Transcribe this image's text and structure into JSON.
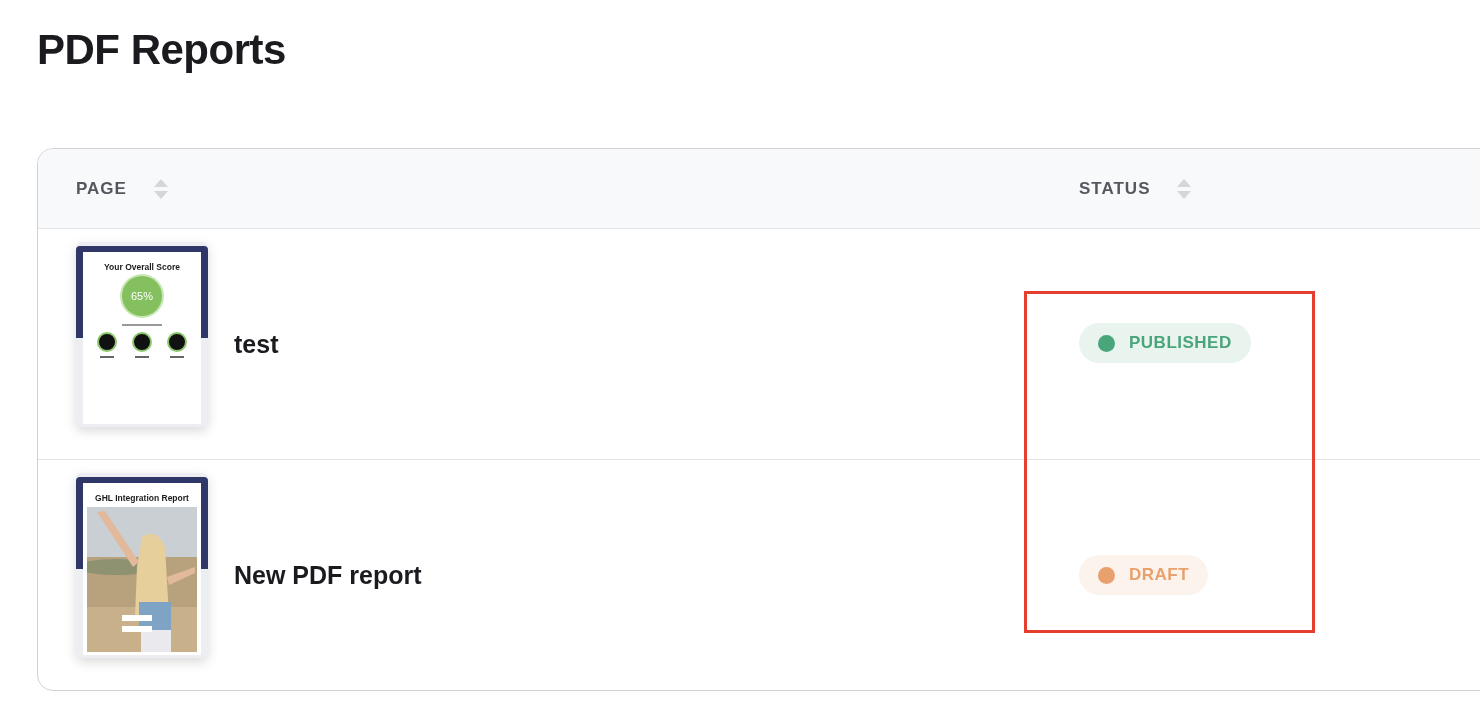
{
  "title": "PDF Reports",
  "table": {
    "columns": [
      {
        "label": "PAGE"
      },
      {
        "label": "STATUS"
      }
    ],
    "rows": [
      {
        "name": "test",
        "thumbnail": {
          "kind": "score",
          "title": "Your Overall Score",
          "score": "65%"
        },
        "status": {
          "label": "PUBLISHED",
          "color": "#4aa57a"
        }
      },
      {
        "name": "New PDF report",
        "thumbnail": {
          "kind": "cover",
          "title": "GHL Integration Report"
        },
        "status": {
          "label": "DRAFT",
          "color": "#e8a06c"
        }
      }
    ]
  }
}
